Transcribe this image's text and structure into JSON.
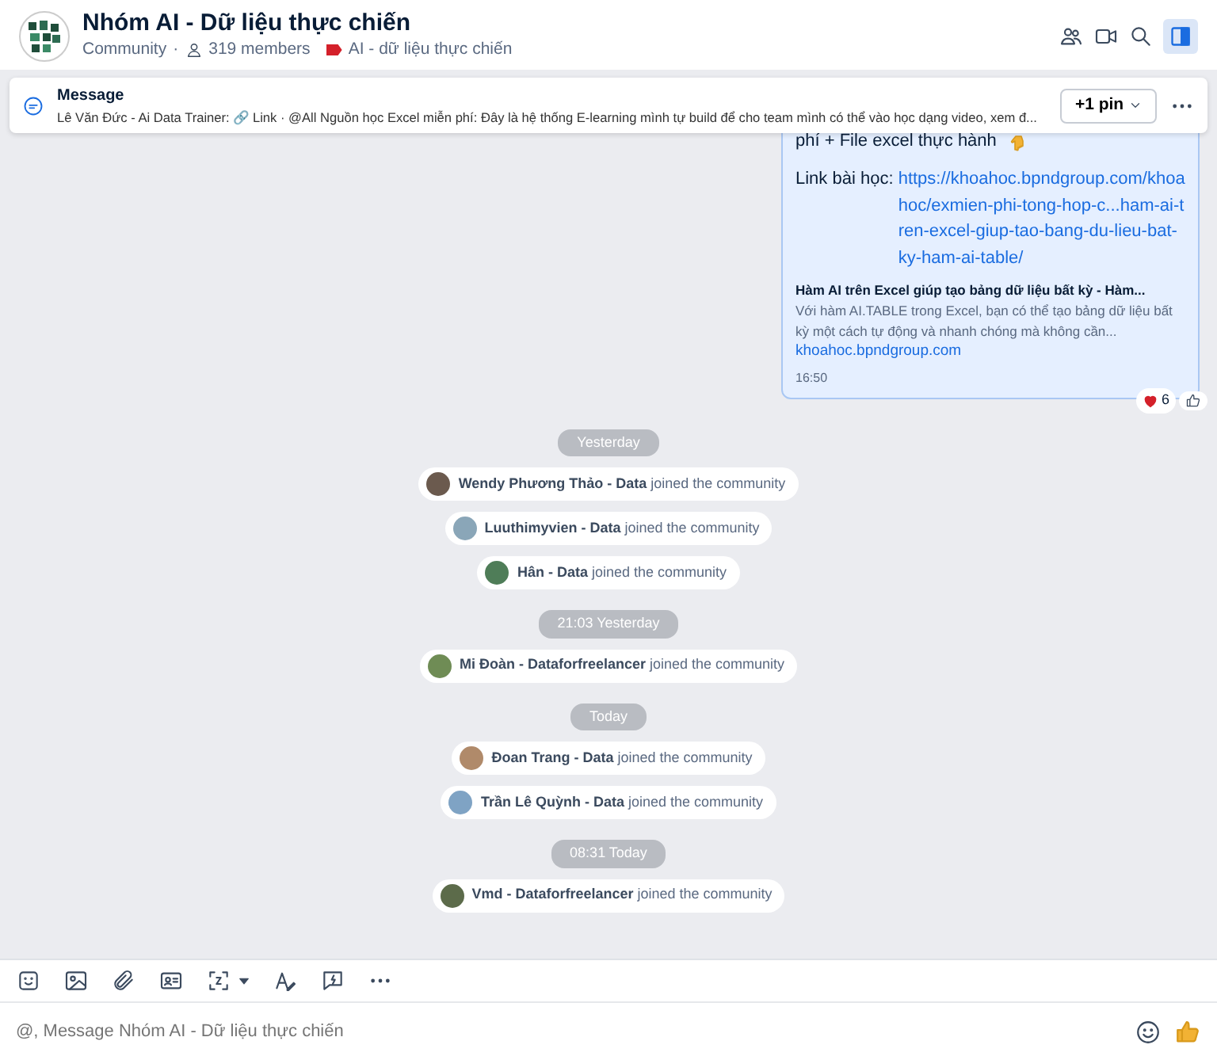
{
  "header": {
    "title": "Nhóm AI - Dữ liệu thực chiến",
    "type": "Community",
    "separator": "·",
    "members": "319 members",
    "topic": "AI - dữ liệu thực chiến"
  },
  "pinned": {
    "label": "Message",
    "text": "Lê Văn Đức - Ai Data Trainer: 🔗 Link · @All Nguồn học Excel miễn phí: Đây là hệ thống E-learning mình tự build để cho team mình có thể vào học dạng video, xem đ...",
    "pin_button": "+1 pin"
  },
  "message": {
    "lines": [
      "phí + File excel thực hành"
    ],
    "link_label": "Link bài học: ",
    "link": "https://khoahoc.bpndgroup.com/khoahoc/exmien-phi-tong-hop-c...ham-ai-tren-excel-giup-tao-bang-du-lieu-bat-ky-ham-ai-table/",
    "preview_title": "Hàm AI trên Excel giúp tạo bảng dữ liệu bất kỳ - Hàm...",
    "preview_text": "Với hàm AI.TABLE trong Excel, bạn có thể tạo bảng dữ liệu bất kỳ một cách tự động và nhanh chóng mà không cần...",
    "preview_domain": "khoahoc.bpndgroup.com",
    "time": "16:50",
    "reaction_count": "6"
  },
  "events": [
    {
      "kind": "date",
      "text": "Yesterday"
    },
    {
      "kind": "join",
      "text": "**Wendy Phương Thảo - Data** joined the community"
    },
    {
      "kind": "join",
      "text": "**Luuthimyvien - Data** joined the community"
    },
    {
      "kind": "join",
      "text": "**Hân - Data** joined the community"
    },
    {
      "kind": "date",
      "text": "21:03 Yesterday"
    },
    {
      "kind": "join",
      "text": "**Mi Đoàn - Dataforfreelancer** joined the community"
    },
    {
      "kind": "date",
      "text": "Today"
    },
    {
      "kind": "join",
      "text": "**Đoan Trang - Data** joined the community"
    },
    {
      "kind": "join",
      "text": "**Trần Lê Quỳnh - Data** joined the community"
    },
    {
      "kind": "date",
      "text": "08:31 Today"
    },
    {
      "kind": "join",
      "text": "**Vmd - Dataforfreelancer** joined the community"
    }
  ],
  "composer": {
    "placeholder": "@, Message Nhóm AI - Dữ liệu thực chiến"
  }
}
